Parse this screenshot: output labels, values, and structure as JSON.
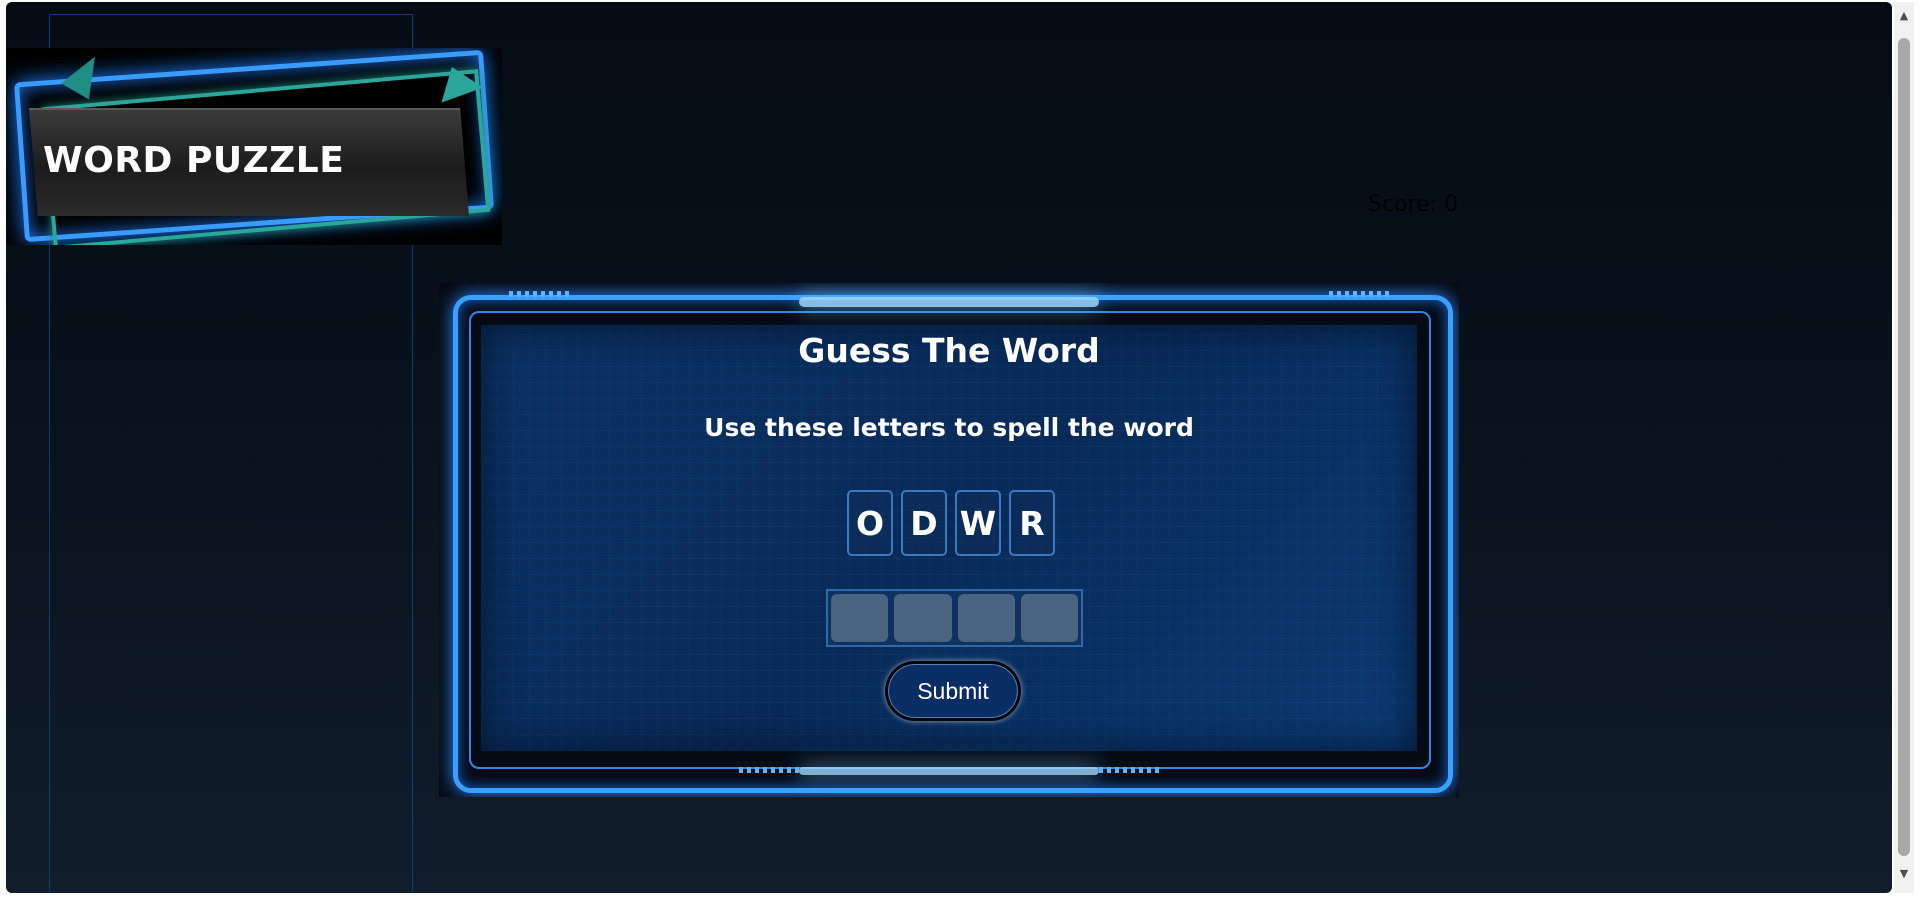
{
  "logo": {
    "title": "WORD PUZZLE"
  },
  "score": {
    "text": "Score: 0"
  },
  "game": {
    "title": "Guess The Word",
    "instructions": "Use these letters to spell the word",
    "letters": [
      "O",
      "D",
      "W",
      "R"
    ],
    "answer_slots": 4,
    "submit_label": "Submit"
  },
  "colors": {
    "background": "#08121c",
    "panel_frame": "#3aa0ff",
    "screen": "#0b3163",
    "submit_button": "#0a2d66",
    "slot": "#4a6380"
  },
  "scrollbar": {
    "up_icon": "triangle-up",
    "down_icon": "triangle-down"
  }
}
